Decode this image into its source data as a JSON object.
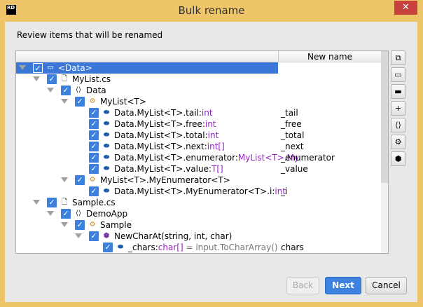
{
  "window": {
    "title": "Bulk rename",
    "app_icon": "RD",
    "close": "✕"
  },
  "subtitle": "Review items that will be renamed",
  "tree": {
    "column_header": "New name",
    "rows": [
      {
        "level": 0,
        "icon": "csharp-project-icon",
        "label": "<Data>",
        "type": "",
        "rest": "",
        "new_name": "",
        "selected": true,
        "expander": true
      },
      {
        "level": 1,
        "icon": "csharp-file-icon",
        "label": "MyList.cs",
        "type": "",
        "rest": "",
        "new_name": "",
        "expander": true
      },
      {
        "level": 2,
        "icon": "namespace-icon",
        "label": "Data",
        "type": "",
        "rest": "",
        "new_name": "",
        "expander": true
      },
      {
        "level": 3,
        "icon": "class-icon",
        "label": "MyList<T>",
        "type": "",
        "rest": "",
        "new_name": "",
        "expander": true
      },
      {
        "level": 4,
        "icon": "field-icon",
        "label": "Data.MyList<T>.tail:",
        "type": "int",
        "rest": "",
        "new_name": "_tail"
      },
      {
        "level": 4,
        "icon": "field-icon",
        "label": "Data.MyList<T>.free:",
        "type": "int",
        "rest": "",
        "new_name": "_free"
      },
      {
        "level": 4,
        "icon": "field-icon",
        "label": "Data.MyList<T>.total:",
        "type": "int",
        "rest": "",
        "new_name": "_total"
      },
      {
        "level": 4,
        "icon": "field-icon",
        "label": "Data.MyList<T>.next:",
        "type": "int[]",
        "rest": "",
        "new_name": "_next"
      },
      {
        "level": 4,
        "icon": "field-icon",
        "label": "Data.MyList<T>.enumerator:",
        "type": "MyList<T>.My",
        "rest": "",
        "new_name": "_enumerator"
      },
      {
        "level": 4,
        "icon": "field-icon",
        "label": "Data.MyList<T>.value:",
        "type": "T[]",
        "rest": "",
        "new_name": "_value"
      },
      {
        "level": 3,
        "icon": "class-icon",
        "label": "MyList<T>.MyEnumerator<T>",
        "type": "",
        "rest": "",
        "new_name": "",
        "expander": true
      },
      {
        "level": 4,
        "icon": "field-icon",
        "label": "Data.MyList<T>.MyEnumerator<T>.i:",
        "type": "int",
        "rest": "",
        "new_name": "_i"
      },
      {
        "level": 1,
        "icon": "csharp-file-icon",
        "label": "Sample.cs",
        "type": "",
        "rest": "",
        "new_name": "",
        "expander": true
      },
      {
        "level": 2,
        "icon": "namespace-icon",
        "label": "DemoApp",
        "type": "",
        "rest": "",
        "new_name": "",
        "expander": true
      },
      {
        "level": 3,
        "icon": "class-icon",
        "label": "Sample",
        "type": "",
        "rest": "",
        "new_name": "",
        "expander": true
      },
      {
        "level": 4,
        "icon": "method-icon",
        "label": "NewCharAt(string, int, char)",
        "type": "",
        "rest": "",
        "new_name": "",
        "expander": true
      },
      {
        "level": 5,
        "icon": "local-variable-icon",
        "label": "_chars:",
        "type": "char[]",
        "rest": " = input.ToCharArray()",
        "new_name": "chars"
      }
    ]
  },
  "toolbar": [
    {
      "icon": "collapse-all-icon",
      "glyph": "⧉"
    },
    {
      "icon": "csharp-project-icon",
      "glyph": "▭"
    },
    {
      "icon": "folder-icon",
      "glyph": "▬"
    },
    {
      "icon": "add-file-icon",
      "glyph": "+"
    },
    {
      "icon": "namespace-icon",
      "glyph": "⟨⟩"
    },
    {
      "icon": "class-icon",
      "glyph": "⚙"
    },
    {
      "icon": "method-icon",
      "glyph": "⬢"
    }
  ],
  "buttons": {
    "back": "Back",
    "next": "Next",
    "cancel": "Cancel"
  }
}
